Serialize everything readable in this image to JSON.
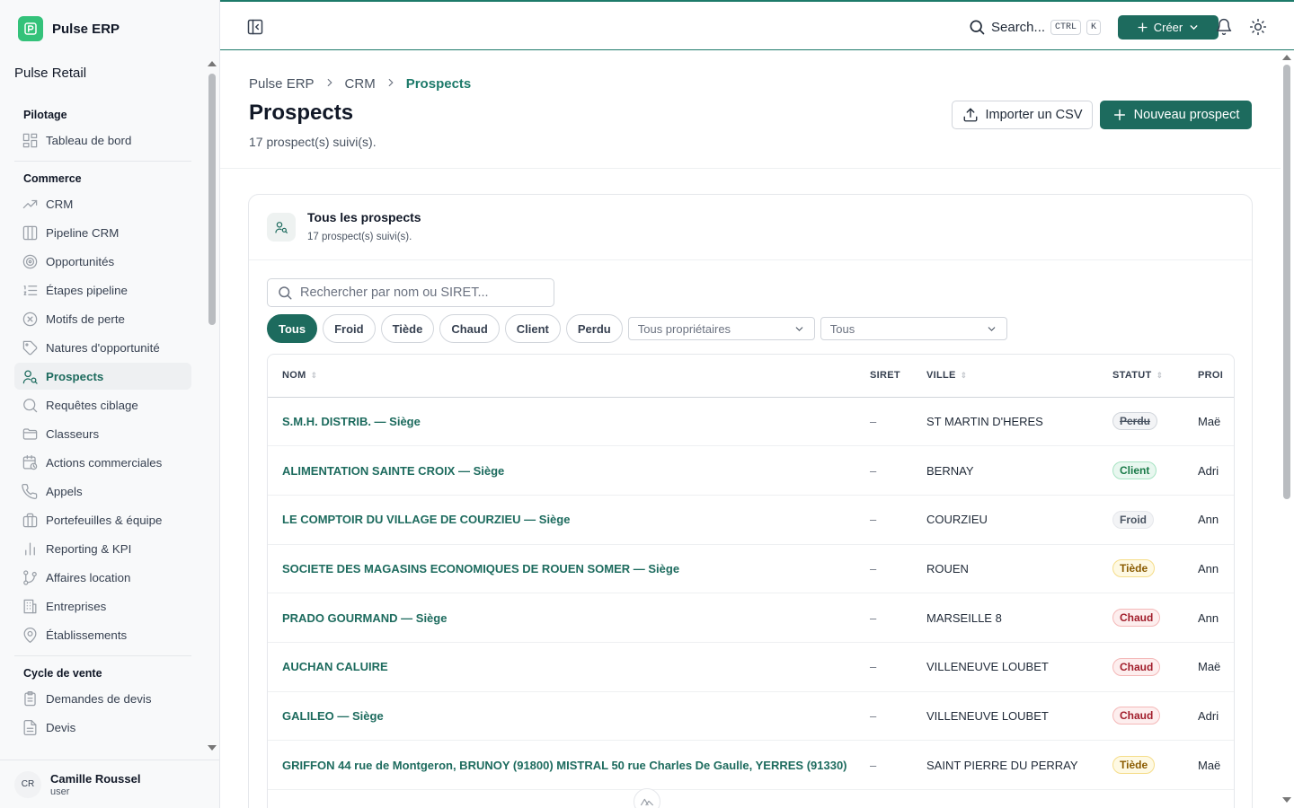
{
  "app": {
    "name": "Pulse ERP",
    "organization": "Pulse Retail"
  },
  "sidebar": {
    "sections": [
      {
        "title": "Pilotage",
        "items": [
          {
            "label": "Tableau de bord",
            "icon": "dashboard-icon"
          }
        ]
      },
      {
        "title": "Commerce",
        "items": [
          {
            "label": "CRM",
            "icon": "trending-up-icon"
          },
          {
            "label": "Pipeline CRM",
            "icon": "kanban-icon"
          },
          {
            "label": "Opportunités",
            "icon": "target-icon"
          },
          {
            "label": "Étapes pipeline",
            "icon": "list-ordered-icon"
          },
          {
            "label": "Motifs de perte",
            "icon": "x-circle-icon"
          },
          {
            "label": "Natures d'opportunité",
            "icon": "tag-icon"
          },
          {
            "label": "Prospects",
            "icon": "user-search-icon",
            "active": true
          },
          {
            "label": "Requêtes ciblage",
            "icon": "search-icon"
          },
          {
            "label": "Classeurs",
            "icon": "folder-icon"
          },
          {
            "label": "Actions commerciales",
            "icon": "calendar-clock-icon"
          },
          {
            "label": "Appels",
            "icon": "phone-icon"
          },
          {
            "label": "Portefeuilles & équipe",
            "icon": "briefcase-icon"
          },
          {
            "label": "Reporting & KPI",
            "icon": "bar-chart-icon"
          },
          {
            "label": "Affaires location",
            "icon": "git-branch-icon"
          },
          {
            "label": "Entreprises",
            "icon": "building-icon"
          },
          {
            "label": "Établissements",
            "icon": "map-pin-icon"
          }
        ]
      },
      {
        "title": "Cycle de vente",
        "items": [
          {
            "label": "Demandes de devis",
            "icon": "clipboard-icon"
          },
          {
            "label": "Devis",
            "icon": "file-text-icon"
          }
        ]
      }
    ],
    "user": {
      "initials": "CR",
      "name": "Camille Roussel",
      "role": "user"
    }
  },
  "topbar": {
    "search_label": "Search...",
    "kbd_ctrl": "CTRL",
    "kbd_k": "K",
    "create_label": "Créer"
  },
  "page": {
    "breadcrumb": [
      "Pulse ERP",
      "CRM",
      "Prospects"
    ],
    "title": "Prospects",
    "subtitle": "17 prospect(s) suivi(s).",
    "import_label": "Importer un CSV",
    "new_label": "Nouveau prospect"
  },
  "card": {
    "title": "Tous les prospects",
    "subtitle": "17 prospect(s) suivi(s).",
    "search_placeholder": "Rechercher par nom ou SIRET...",
    "chips": [
      "Tous",
      "Froid",
      "Tiède",
      "Chaud",
      "Client",
      "Perdu"
    ],
    "active_chip": "Tous",
    "owner_select": "Tous propriétaires",
    "second_select": "Tous"
  },
  "table": {
    "columns": [
      "NOM",
      "SIRET",
      "VILLE",
      "STATUT",
      "PROI"
    ],
    "rows": [
      {
        "nom": "S.M.H. DISTRIB. — Siège",
        "siret": "–",
        "ville": "ST MARTIN D'HERES",
        "statut": "Perdu",
        "proprietaire": "Maë"
      },
      {
        "nom": "ALIMENTATION SAINTE CROIX — Siège",
        "siret": "–",
        "ville": "BERNAY",
        "statut": "Client",
        "proprietaire": "Adri"
      },
      {
        "nom": "LE COMPTOIR DU VILLAGE DE COURZIEU — Siège",
        "siret": "–",
        "ville": "COURZIEU",
        "statut": "Froid",
        "proprietaire": "Ann"
      },
      {
        "nom": "SOCIETE DES MAGASINS ECONOMIQUES DE ROUEN SOMER — Siège",
        "siret": "–",
        "ville": "ROUEN",
        "statut": "Tiède",
        "proprietaire": "Ann"
      },
      {
        "nom": "PRADO GOURMAND — Siège",
        "siret": "–",
        "ville": "MARSEILLE 8",
        "statut": "Chaud",
        "proprietaire": "Ann"
      },
      {
        "nom": "AUCHAN CALUIRE",
        "siret": "–",
        "ville": "VILLENEUVE LOUBET",
        "statut": "Chaud",
        "proprietaire": "Maë"
      },
      {
        "nom": "GALILEO — Siège",
        "siret": "–",
        "ville": "VILLENEUVE LOUBET",
        "statut": "Chaud",
        "proprietaire": "Adri"
      },
      {
        "nom": "GRIFFON 44 rue de Montgeron, BRUNOY (91800) MISTRAL 50 rue Charles De Gaulle, YERRES (91330)",
        "siret": "–",
        "ville": "SAINT PIERRE DU PERRAY",
        "statut": "Tiède",
        "proprietaire": "Maë"
      }
    ]
  },
  "colors": {
    "accent": "#1d6b5e",
    "brand_logo": "#34c27a",
    "topbar_border": "#1d7a6a"
  }
}
